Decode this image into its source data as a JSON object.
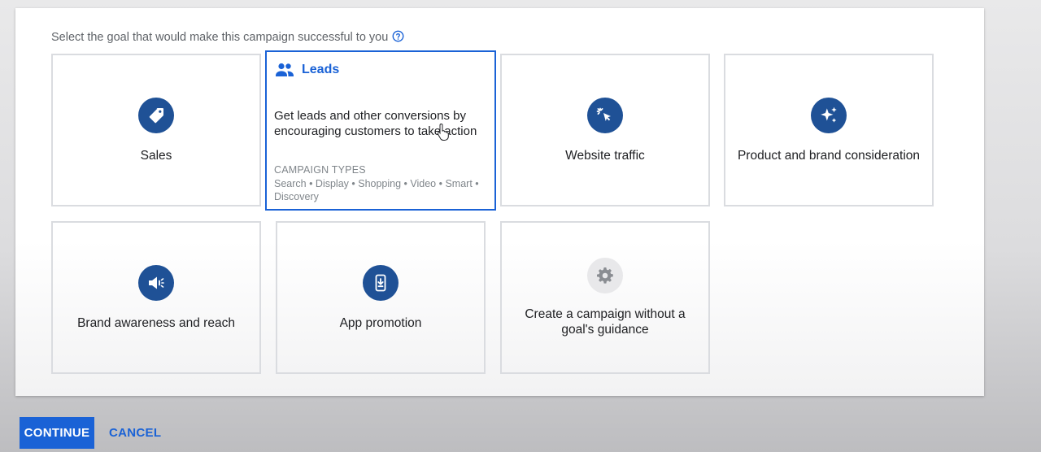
{
  "heading": "Select the goal that would make this campaign successful to you",
  "icons": {
    "help": "question-circle-icon",
    "sales": "tag-icon",
    "leads": "people-icon",
    "website_traffic": "cursor-click-icon",
    "product_brand": "sparkle-icon",
    "brand_awareness": "megaphone-icon",
    "app_promotion": "mobile-download-icon",
    "no_goal": "gear-icon"
  },
  "goals": {
    "sales": "Sales",
    "leads": {
      "title": "Leads",
      "description": "Get leads and other conversions by encouraging customers to take action",
      "campaign_types_label": "CAMPAIGN TYPES",
      "campaign_types": "Search • Display • Shopping • Video • Smart • Discovery"
    },
    "website_traffic": "Website traffic",
    "product_brand": "Product and brand consideration",
    "brand_awareness": "Brand awareness and reach",
    "app_promotion": "App promotion",
    "no_goal": "Create a campaign without a goal's guidance"
  },
  "actions": {
    "continue": "CONTINUE",
    "cancel": "CANCEL"
  },
  "colors": {
    "accent": "#1a62d6",
    "icon_circle": "#1f5196",
    "border": "#dadce0"
  }
}
